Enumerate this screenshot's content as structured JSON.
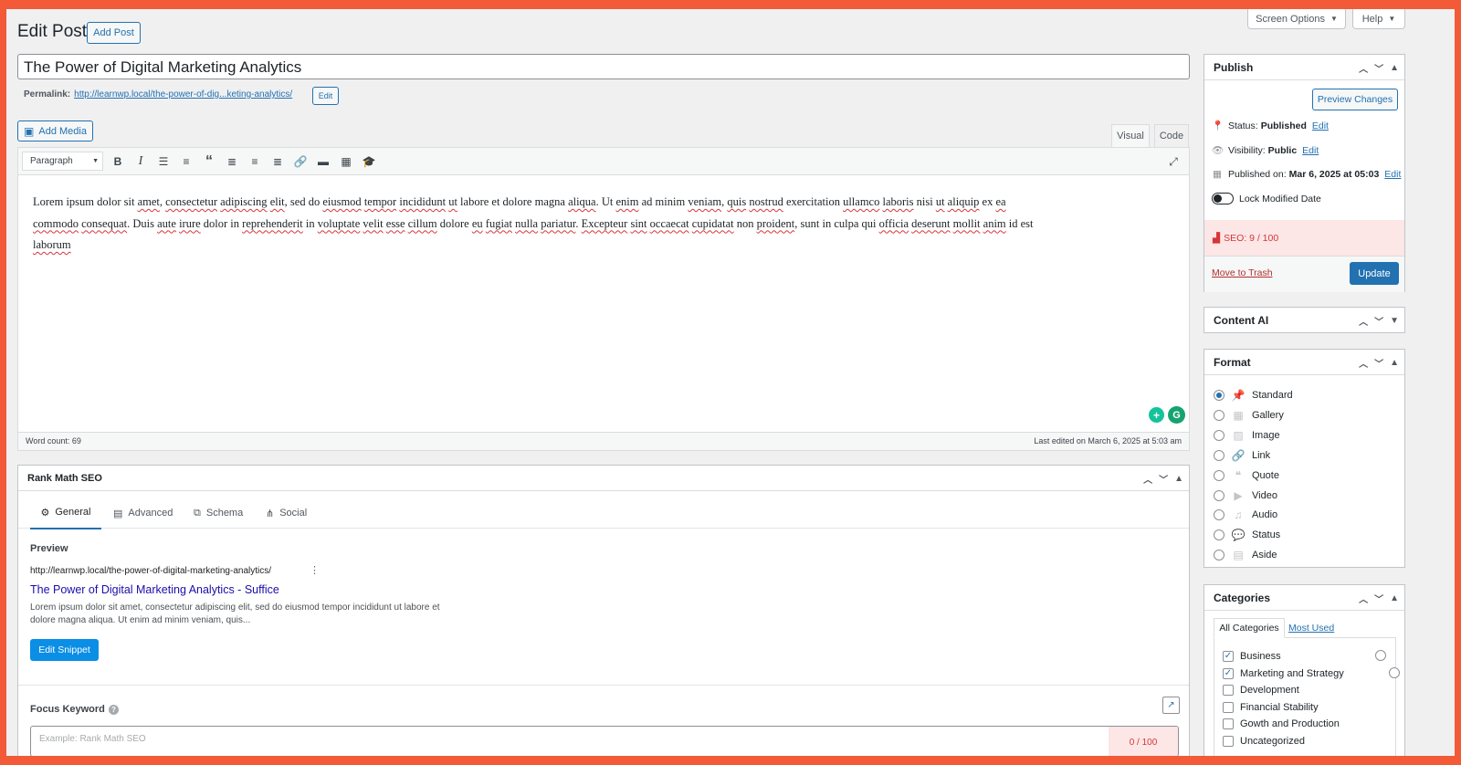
{
  "header": {
    "title": "Edit Post",
    "add_post": "Add Post"
  },
  "top_tabs": {
    "screen_options": "Screen Options",
    "help": "Help",
    "caret": "▼"
  },
  "post": {
    "title": "The Power of Digital Marketing Analytics",
    "permalink_label": "Permalink:",
    "permalink_url": "http://learnwp.local/the-power-of-dig...keting-analytics/",
    "permalink_edit": "Edit"
  },
  "editor": {
    "add_media": "Add Media",
    "tab_visual": "Visual",
    "tab_code": "Code",
    "format_select": "Paragraph",
    "paragraph_line1": [
      "Lorem ipsum dolor sit ",
      "amet",
      ", ",
      "consectetur",
      " ",
      "adipiscing",
      " ",
      "elit",
      ", sed do ",
      "eiusmod",
      " ",
      "tempor",
      " ",
      "incididunt",
      " ",
      "ut",
      " labore et dolore magna ",
      "aliqua",
      ". Ut ",
      "enim",
      " ad minim ",
      "veniam",
      ", ",
      "quis",
      " ",
      "nostrud",
      " exercitation ",
      "ullamco",
      " ",
      "laboris",
      " nisi ",
      "ut",
      " ",
      "aliquip",
      " ex ",
      "ea"
    ],
    "paragraph_line2": [
      "commodo",
      " ",
      "consequat",
      ". Duis ",
      "aute",
      " ",
      "irure",
      " dolor in ",
      "reprehenderit",
      " in ",
      "voluptate",
      " ",
      "velit",
      " ",
      "esse",
      " ",
      "cillum",
      " dolore ",
      "eu",
      " ",
      "fugiat",
      " ",
      "nulla",
      " ",
      "pariatur",
      ". ",
      "Excepteur",
      " ",
      "sint",
      " ",
      "occaecat",
      " ",
      "cupidatat",
      " non ",
      "proident",
      ", sunt in culpa qui ",
      "officia",
      " ",
      "deserunt",
      " ",
      "mollit",
      " ",
      "anim",
      " id est"
    ],
    "paragraph_line3": [
      "laborum"
    ],
    "word_count": "Word count: 69",
    "last_edited": "Last edited on March 6, 2025 at 5:03 am"
  },
  "publish": {
    "title": "Publish",
    "preview_changes": "Preview Changes",
    "status_label": "Status:",
    "status_value": "Published",
    "visibility_label": "Visibility:",
    "visibility_value": "Public",
    "published_label": "Published on:",
    "published_value": "Mar 6, 2025 at 05:03",
    "edit": "Edit",
    "lock_modified": "Lock Modified Date",
    "seo_score": "SEO: 9 / 100",
    "move_to_trash": "Move to Trash",
    "update": "Update"
  },
  "content_ai": {
    "title": "Content AI"
  },
  "format": {
    "title": "Format",
    "options": [
      {
        "label": "Standard",
        "icon": "pin-icon",
        "checked": true
      },
      {
        "label": "Gallery",
        "icon": "gallery-icon",
        "checked": false
      },
      {
        "label": "Image",
        "icon": "image-icon",
        "checked": false
      },
      {
        "label": "Link",
        "icon": "link-icon",
        "checked": false
      },
      {
        "label": "Quote",
        "icon": "quote-icon",
        "checked": false
      },
      {
        "label": "Video",
        "icon": "video-icon",
        "checked": false
      },
      {
        "label": "Audio",
        "icon": "audio-icon",
        "checked": false
      },
      {
        "label": "Status",
        "icon": "status-icon",
        "checked": false
      },
      {
        "label": "Aside",
        "icon": "aside-icon",
        "checked": false
      }
    ]
  },
  "categories": {
    "title": "Categories",
    "tab_all": "All Categories",
    "tab_most_used": "Most Used",
    "items": [
      {
        "label": "Business",
        "checked": true
      },
      {
        "label": "Marketing and Strategy",
        "checked": true
      },
      {
        "label": "Development",
        "checked": false
      },
      {
        "label": "Financial Stability",
        "checked": false
      },
      {
        "label": "Gowth and Production",
        "checked": false
      },
      {
        "label": "Uncategorized",
        "checked": false
      }
    ]
  },
  "rank_math": {
    "title": "Rank Math SEO",
    "tabs": [
      "General",
      "Advanced",
      "Schema",
      "Social"
    ],
    "preview_label": "Preview",
    "preview_url": "http://learnwp.local/the-power-of-digital-marketing-analytics/",
    "preview_title": "The Power of Digital Marketing Analytics - Suffice",
    "preview_desc_1": "Lorem ipsum dolor sit amet, consectetur adipiscing elit, sed do eiusmod tempor incididunt ut labore et",
    "preview_desc_2": "dolore magna aliqua. Ut enim ad minim veniam, quis...",
    "edit_snippet": "Edit Snippet",
    "focus_keyword_label": "Focus Keyword",
    "focus_keyword_placeholder": "Example: Rank Math SEO",
    "focus_score": "0 / 100"
  },
  "colors": {
    "accent": "#2271b1",
    "frame": "#f25a38",
    "seo_bg": "#fde6e6",
    "seo_text": "#d63638",
    "snippet_btn": "#0a8ee6"
  }
}
